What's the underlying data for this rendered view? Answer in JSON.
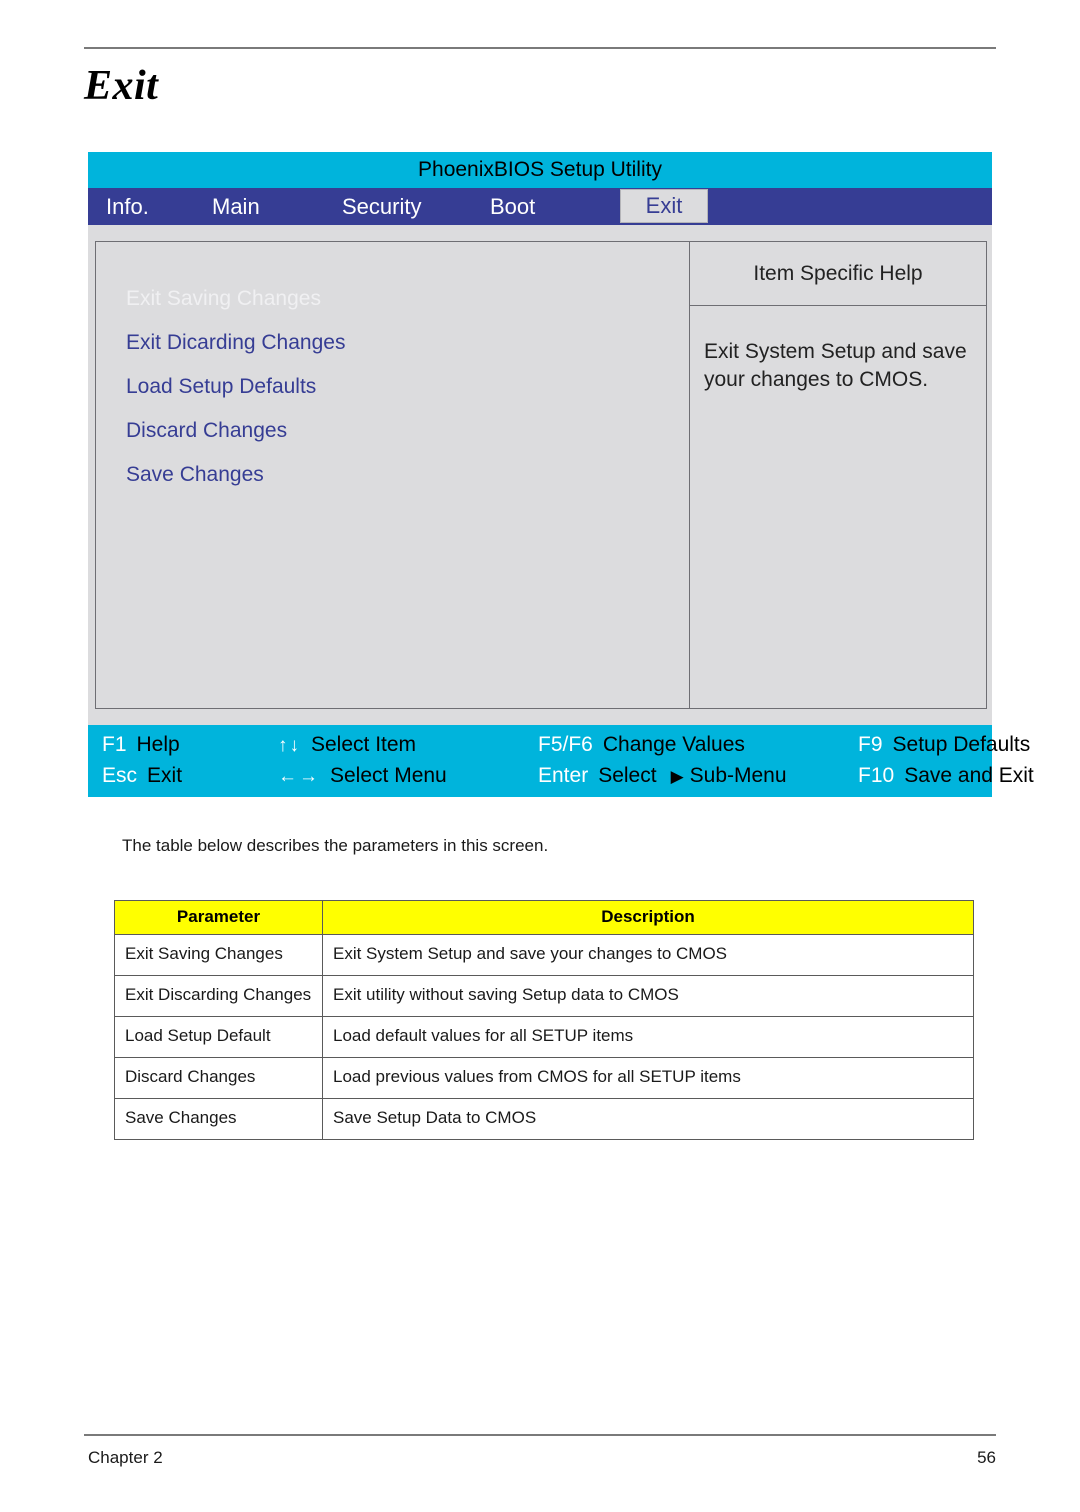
{
  "page": {
    "title": "Exit",
    "body_paragraph": "The table below describes the parameters in this screen.",
    "footer_left": "Chapter 2",
    "footer_right": "56"
  },
  "colors": {
    "title_bar": "#00b4dc",
    "tab_bar": "#363d94",
    "panel_bg": "#dcdcde",
    "menu_link": "#363d94",
    "selected_item": "#f0f0f2",
    "table_header": "#ffff00",
    "key_name": "#ffffff",
    "key_desc": "#000000"
  },
  "bios": {
    "title": "PhoenixBIOS Setup Utility",
    "tabs": [
      {
        "label": "Info.",
        "active": false
      },
      {
        "label": "Main",
        "active": false
      },
      {
        "label": "Security",
        "active": false
      },
      {
        "label": "Boot",
        "active": false
      },
      {
        "label": "Exit",
        "active": true
      }
    ],
    "menu_items": [
      {
        "label": "Exit Saving Changes",
        "selected": true
      },
      {
        "label": "Exit Dicarding Changes",
        "selected": false
      },
      {
        "label": "Load Setup Defaults",
        "selected": false
      },
      {
        "label": "Discard Changes",
        "selected": false
      },
      {
        "label": "Save Changes",
        "selected": false
      }
    ],
    "help": {
      "heading": "Item Specific Help",
      "text": "Exit System Setup and save your changes to CMOS."
    },
    "keys": {
      "row1": [
        {
          "name": "F1",
          "desc": "Help"
        },
        {
          "name": "↑↓",
          "desc": "Select Item"
        },
        {
          "name": "F5/F6",
          "desc": "Change Values"
        },
        {
          "name": "F9",
          "desc": "Setup Defaults"
        }
      ],
      "row2": [
        {
          "name": "Esc",
          "desc": "Exit"
        },
        {
          "name": "←→",
          "desc": "Select Menu"
        },
        {
          "name": "Enter",
          "desc": "Select",
          "submenu_glyph": "▶",
          "submenu_label": "Sub-Menu"
        },
        {
          "name": "F10",
          "desc": "Save and Exit"
        }
      ]
    }
  },
  "table": {
    "headers": [
      "Parameter",
      "Description"
    ],
    "rows": [
      {
        "parameter": "Exit Saving Changes",
        "description": "Exit System Setup and save your changes to CMOS"
      },
      {
        "parameter": "Exit Discarding Changes",
        "description": "Exit utility without saving Setup data to CMOS"
      },
      {
        "parameter": "Load Setup Default",
        "description": "Load default values for all SETUP items"
      },
      {
        "parameter": "Discard Changes",
        "description": "Load previous values from CMOS for all SETUP items"
      },
      {
        "parameter": "Save Changes",
        "description": "Save Setup Data to CMOS"
      }
    ]
  }
}
